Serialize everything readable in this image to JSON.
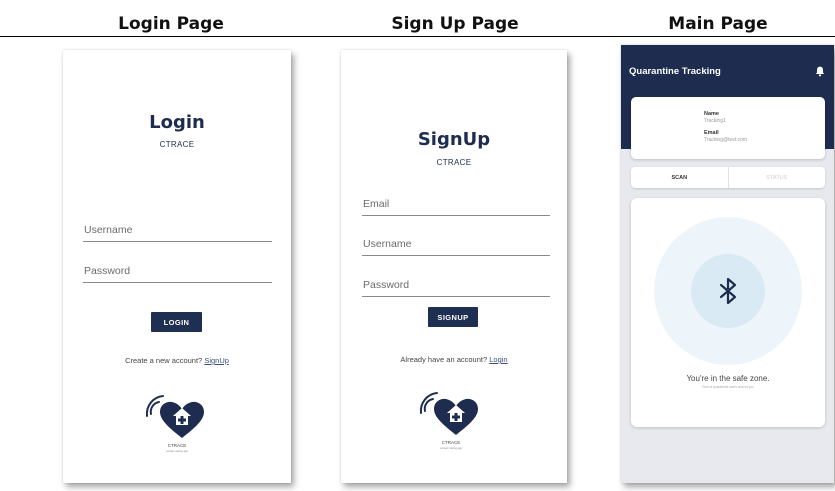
{
  "columns": {
    "login": "Login Page",
    "signup": "Sign Up Page",
    "main": "Main Page"
  },
  "login": {
    "title": "Login",
    "subtitle": "CTRACE",
    "username_placeholder": "Username",
    "password_placeholder": "Password",
    "button_label": "LOGIN",
    "switch_text": "Create a new account?",
    "switch_link": "SignUp",
    "logo_caption": "CTRACE",
    "logo_tagline": "contact tracing app"
  },
  "signup": {
    "title": "SignUp",
    "subtitle": "CTRACE",
    "email_placeholder": "Email",
    "username_placeholder": "Username",
    "password_placeholder": "Password",
    "button_label": "SIGNUP",
    "switch_text": "Already have an account?",
    "switch_link": "Login",
    "logo_caption": "CTRACE",
    "logo_tagline": "contact tracing app"
  },
  "main": {
    "app_title": "Quarantine Tracking",
    "name_label": "Name",
    "name_value": "Tracking1",
    "email_label": "Email",
    "email_value": "Tracking@test.com",
    "tab_scan": "SCAN",
    "tab_status": "STATUS",
    "safe_message": "You're in the safe zone.",
    "safe_submessage": "Rest of quarantine users around you",
    "icons": [
      "bell-icon",
      "bluetooth-icon"
    ]
  },
  "colors": {
    "navy": "#1e2d4f",
    "scan_ring_outer": "#eef5fa",
    "scan_ring_inner": "#d9eaf4",
    "panel_bg": "#e7e9ee"
  }
}
